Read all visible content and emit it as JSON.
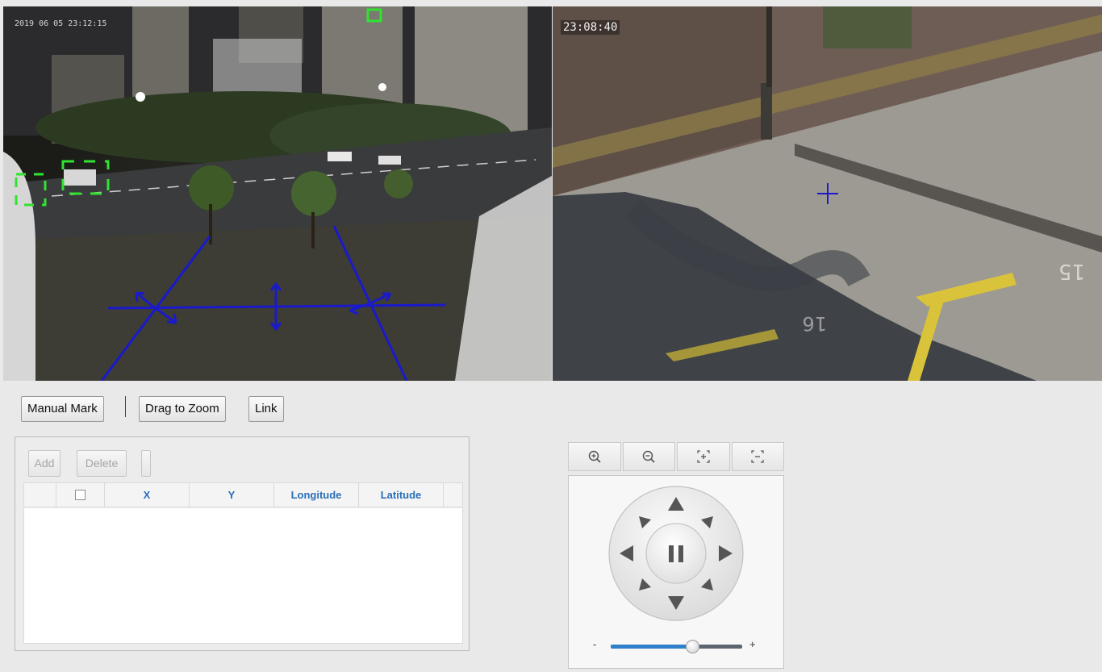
{
  "left_view": {
    "timestamp": "2019 06 05 23:12:15",
    "name": "panorama-camera-view"
  },
  "right_view": {
    "timestamp": "23:08:40",
    "name": "ptz-camera-view"
  },
  "toolbar": {
    "manual_mark_label": "Manual Mark",
    "drag_to_zoom_label": "Drag to Zoom",
    "link_label": "Link"
  },
  "mark_panel": {
    "add_label": "Add",
    "delete_label": "Delete",
    "columns": [
      "X",
      "Y",
      "Longitude",
      "Latitude"
    ],
    "rows": []
  },
  "ptz": {
    "toolbar_icons": [
      "zoom-in-icon",
      "zoom-out-icon",
      "focus-near-icon",
      "focus-far-icon"
    ],
    "zoom_min_label": "-",
    "zoom_max_label": "+",
    "zoom_level": 0.62
  },
  "colors": {
    "overlay_lines": "#1a1acc",
    "detection_box": "#31e331",
    "header_text": "#2a6eb8",
    "slider_fill": "#2f7fcb"
  }
}
